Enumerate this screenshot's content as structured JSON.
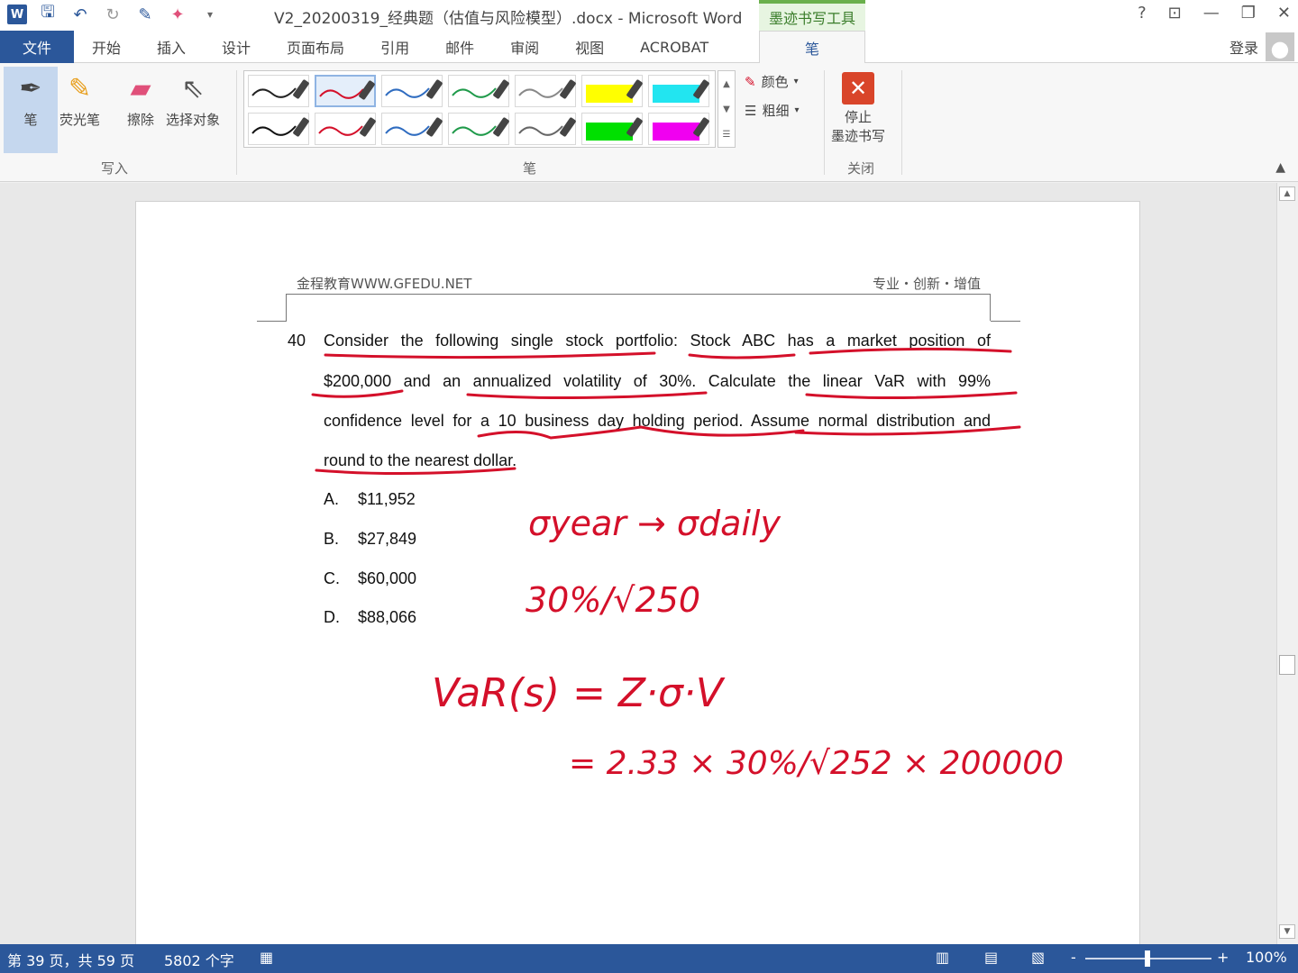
{
  "window": {
    "title": "V2_20200319_经典题（估值与风险模型）.docx - Microsoft Word",
    "contextual_tab": "墨迹书写工具",
    "help": "?",
    "controls": [
      "restore-ribbon",
      "minimize",
      "maximize",
      "close"
    ]
  },
  "tabs": {
    "file": "文件",
    "items": [
      "开始",
      "插入",
      "设计",
      "页面布局",
      "引用",
      "邮件",
      "审阅",
      "视图",
      "ACROBAT"
    ],
    "active": "笔",
    "login": "登录"
  },
  "ribbon": {
    "write_group": {
      "label": "写入",
      "pen": "笔",
      "highlighter": "荧光笔",
      "eraser": "擦除",
      "select": "选择对象"
    },
    "pens_group": {
      "label": "笔",
      "styles": [
        {
          "color": "#222222",
          "kind": "pen"
        },
        {
          "color": "#d4102a",
          "kind": "pen",
          "selected": true
        },
        {
          "color": "#2f6cc0",
          "kind": "pen"
        },
        {
          "color": "#1f9a4a",
          "kind": "pen"
        },
        {
          "color": "#888888",
          "kind": "pen"
        },
        {
          "color": "#ffff00",
          "kind": "highlighter"
        },
        {
          "color": "#22e5f0",
          "kind": "highlighter"
        },
        {
          "color": "#111111",
          "kind": "pen"
        },
        {
          "color": "#d4102a",
          "kind": "pen"
        },
        {
          "color": "#2f6cc0",
          "kind": "pen"
        },
        {
          "color": "#1f9a4a",
          "kind": "pen"
        },
        {
          "color": "#666666",
          "kind": "pen"
        },
        {
          "color": "#00e000",
          "kind": "highlighter"
        },
        {
          "color": "#f000f0",
          "kind": "highlighter"
        }
      ],
      "color_label": "颜色",
      "thickness_label": "粗细"
    },
    "close_group": {
      "label": "关闭",
      "stop_line1": "停止",
      "stop_line2": "墨迹书写"
    }
  },
  "document": {
    "header_left": "金程教育WWW.GFEDU.NET",
    "header_right": "专业・创新・增值",
    "question_number": "40",
    "question_lines": [
      "Consider the following single stock portfolio: Stock ABC has a market position of",
      "$200,000 and an annualized volatility of 30%. Calculate the linear VaR with 99%",
      "confidence level for a 10 business day holding period. Assume normal distribution and",
      "round to the nearest dollar."
    ],
    "options": [
      {
        "letter": "A.",
        "text": "$11,952"
      },
      {
        "letter": "B.",
        "text": "$27,849"
      },
      {
        "letter": "C.",
        "text": "$60,000"
      },
      {
        "letter": "D.",
        "text": "$88,066"
      }
    ],
    "ink_notes": {
      "line1": "σyear → σdaily",
      "line2": "30%/√250",
      "line3": "VaR(s) = Z·σ·V",
      "line4": "= 2.33 × 30%/√252 × 200000"
    },
    "ink_color": "#d4102a"
  },
  "status": {
    "page": "第 39 页，共 59 页",
    "words": "5802 个字",
    "zoom": "100%",
    "zoom_minus": "-",
    "zoom_plus": "+"
  }
}
